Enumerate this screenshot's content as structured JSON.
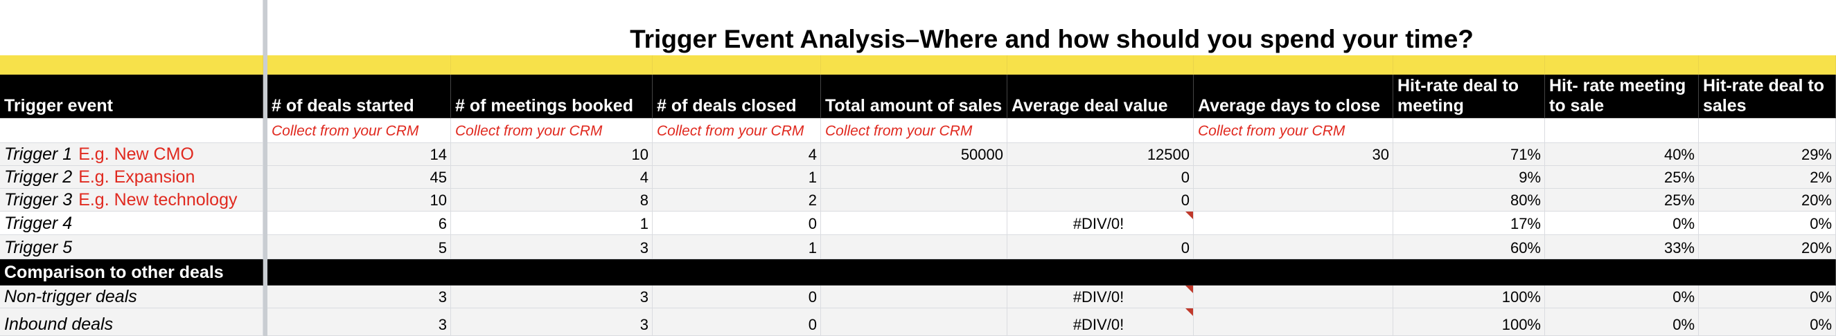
{
  "title": "Trigger Event Analysis–Where and how should you spend your time?",
  "headers": {
    "trigger_event": "Trigger event",
    "deals_started": "# of deals started",
    "meetings_booked": "# of meetings booked",
    "deals_closed": "# of deals closed",
    "total_sales": "Total amount of sales",
    "avg_deal_value": "Average deal value",
    "avg_days_close": "Average days to close",
    "hit_deal_meeting": "Hit-rate deal to meeting",
    "hit_meeting_sale": "Hit- rate meeting to sale",
    "hit_deal_sales": "Hit-rate deal to sales"
  },
  "hint": "Collect from your CRM",
  "rows": [
    {
      "label": "Trigger 1",
      "example": "E.g. New CMO",
      "started": "14",
      "meetings": "10",
      "closed": "4",
      "sales": "50000",
      "avg": "12500",
      "days": "30",
      "h1": "71%",
      "h2": "40%",
      "h3": "29%"
    },
    {
      "label": "Trigger 2",
      "example": "E.g. Expansion",
      "started": "45",
      "meetings": "4",
      "closed": "1",
      "sales": "",
      "avg": "0",
      "days": "",
      "h1": "9%",
      "h2": "25%",
      "h3": "2%"
    },
    {
      "label": "Trigger 3",
      "example": "E.g. New technology",
      "started": "10",
      "meetings": "8",
      "closed": "2",
      "sales": "",
      "avg": "0",
      "days": "",
      "h1": "80%",
      "h2": "25%",
      "h3": "20%"
    },
    {
      "label": "Trigger 4",
      "example": "",
      "started": "6",
      "meetings": "1",
      "closed": "0",
      "sales": "",
      "avg": "#DIV/0!",
      "days": "",
      "h1": "17%",
      "h2": "0%",
      "h3": "0%"
    },
    {
      "label": "Trigger 5",
      "example": "",
      "started": "5",
      "meetings": "3",
      "closed": "1",
      "sales": "",
      "avg": "0",
      "days": "",
      "h1": "60%",
      "h2": "33%",
      "h3": "20%"
    }
  ],
  "comparison_header": "Comparison to other deals",
  "comparison_rows": [
    {
      "label": "Non-trigger deals",
      "started": "3",
      "meetings": "3",
      "closed": "0",
      "sales": "",
      "avg": "#DIV/0!",
      "days": "",
      "h1": "100%",
      "h2": "0%",
      "h3": "0%"
    },
    {
      "label": "Inbound deals",
      "started": "3",
      "meetings": "3",
      "closed": "0",
      "sales": "",
      "avg": "#DIV/0!",
      "days": "",
      "h1": "100%",
      "h2": "0%",
      "h3": "0%"
    }
  ],
  "colors": {
    "yellow_band": "#f7e14a",
    "header_bg": "#000000",
    "hint_red": "#e0291f",
    "error_flag": "#c0392b"
  }
}
